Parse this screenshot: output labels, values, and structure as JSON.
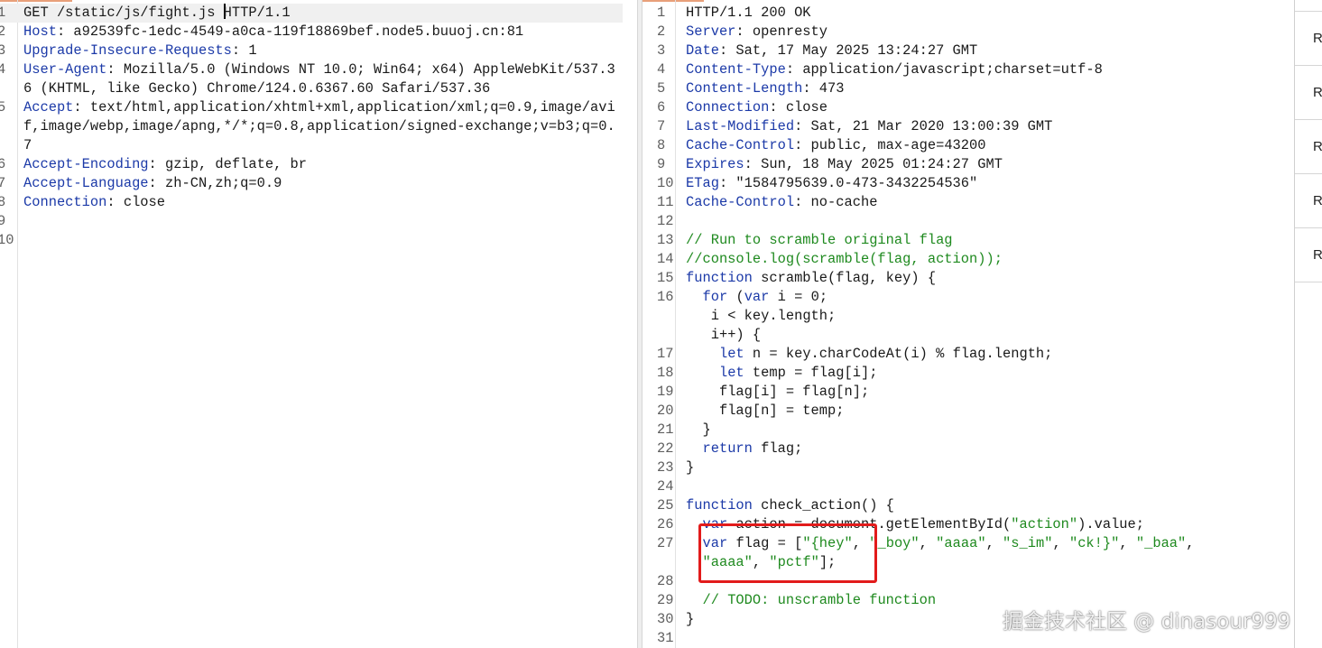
{
  "request": {
    "lines": [
      {
        "n": "1",
        "k": "",
        "t": "GET /static/js/fight.js ",
        "t2": "HTTP/1.1",
        "caret": true,
        "cur": true
      },
      {
        "n": "2",
        "k": "Host",
        "t": ": a92539fc-1edc-4549-a0ca-119f18869bef.node5.buuoj.cn:81"
      },
      {
        "n": "3",
        "k": "Upgrade-Insecure-Requests",
        "t": ": 1"
      },
      {
        "n": "4",
        "k": "User-Agent",
        "t": ": Mozilla/5.0 (Windows NT 10.0; Win64; x64) AppleWebKit/537.36 (KHTML, like Gecko) Chrome/124.0.6367.60 Safari/537.36"
      },
      {
        "n": "5",
        "k": "Accept",
        "t": ": text/html,application/xhtml+xml,application/xml;q=0.9,image/avif,image/webp,image/apng,*/*;q=0.8,application/signed-exchange;v=b3;q=0.7"
      },
      {
        "n": "6",
        "k": "Accept-Encoding",
        "t": ": gzip, deflate, br"
      },
      {
        "n": "7",
        "k": "Accept-Language",
        "t": ": zh-CN,zh;q=0.9"
      },
      {
        "n": "8",
        "k": "Connection",
        "t": ": close"
      },
      {
        "n": "9",
        "k": "",
        "t": ""
      },
      {
        "n": "10",
        "k": "",
        "t": ""
      }
    ]
  },
  "response": {
    "lines": [
      {
        "n": "1",
        "k": "",
        "t": "HTTP/1.1 200 OK"
      },
      {
        "n": "2",
        "k": "Server",
        "t": ": openresty"
      },
      {
        "n": "3",
        "k": "Date",
        "t": ": Sat, 17 May 2025 13:24:27 GMT"
      },
      {
        "n": "4",
        "k": "Content-Type",
        "t": ": application/javascript;charset=utf-8"
      },
      {
        "n": "5",
        "k": "Content-Length",
        "t": ": 473"
      },
      {
        "n": "6",
        "k": "Connection",
        "t": ": close"
      },
      {
        "n": "7",
        "k": "Last-Modified",
        "t": ": Sat, 21 Mar 2020 13:00:39 GMT"
      },
      {
        "n": "8",
        "k": "Cache-Control",
        "t": ": public, max-age=43200"
      },
      {
        "n": "9",
        "k": "Expires",
        "t": ": Sun, 18 May 2025 01:24:27 GMT"
      },
      {
        "n": "10",
        "k": "ETag",
        "t": ": \"1584795639.0-473-3432254536\""
      },
      {
        "n": "11",
        "k": "Cache-Control",
        "t": ": no-cache"
      },
      {
        "n": "12",
        "k": "",
        "t": ""
      },
      {
        "n": "13",
        "c": "// Run to scramble original flag"
      },
      {
        "n": "14",
        "c": "//console.log(scramble(flag, action));"
      },
      {
        "n": "15",
        "w": "function",
        "t": " scramble(flag, key) {"
      },
      {
        "n": "16",
        "i": "  ",
        "w": "for",
        "t": " (",
        "w2": "var",
        "t2": " i = 0;"
      },
      {
        "n": "",
        "t": "   i < key.length;"
      },
      {
        "n": "",
        "t": "   i++) {"
      },
      {
        "n": "17",
        "i": "    ",
        "w": "let",
        "t": " n = key.charCodeAt(i) % flag.length;"
      },
      {
        "n": "18",
        "i": "    ",
        "w": "let",
        "t": " temp = flag[i];"
      },
      {
        "n": "19",
        "t": "    flag[i] = flag[n];"
      },
      {
        "n": "20",
        "t": "    flag[n] = temp;"
      },
      {
        "n": "21",
        "t": "  }"
      },
      {
        "n": "22",
        "i": "  ",
        "w": "return",
        "t": " flag;"
      },
      {
        "n": "23",
        "t": "}"
      },
      {
        "n": "24",
        "t": ""
      },
      {
        "n": "25",
        "w": "function",
        "t": " check_action() {"
      },
      {
        "n": "26",
        "i": "  ",
        "w": "var",
        "t": " action = document.getElementById(",
        "s": "\"action\"",
        "t3": ").value;"
      },
      {
        "n": "27",
        "i": "  ",
        "w": "var",
        "t": " flag = [",
        "s": "\"{hey\"",
        "t3": ", ",
        "s2": "\"_boy\"",
        "t4": ", ",
        "s3": "\"aaaa\"",
        "t5": ", ",
        "s4": "\"s_im\"",
        "t6": ", ",
        "s5": "\"ck!}\"",
        "t7": ", ",
        "s6": "\"_baa\"",
        "t8": ","
      },
      {
        "n": "",
        "i": "  ",
        "s": "\"aaaa\"",
        "t3": ", ",
        "s2": "\"pctf\"",
        "t4": "];"
      },
      {
        "n": "28",
        "t": ""
      },
      {
        "n": "29",
        "i": "  ",
        "c": "// TODO: unscramble function"
      },
      {
        "n": "30",
        "t": "}"
      },
      {
        "n": "31",
        "t": ""
      }
    ]
  },
  "side_panel": {
    "items": [
      "R",
      "R",
      "R",
      "R",
      "R"
    ]
  },
  "watermark": "掘金技术社区 @ dinasour999",
  "colors": {
    "header_key": "#1c3aa8",
    "comment": "#1f8a1f",
    "highlight_box": "#e21b1b"
  }
}
